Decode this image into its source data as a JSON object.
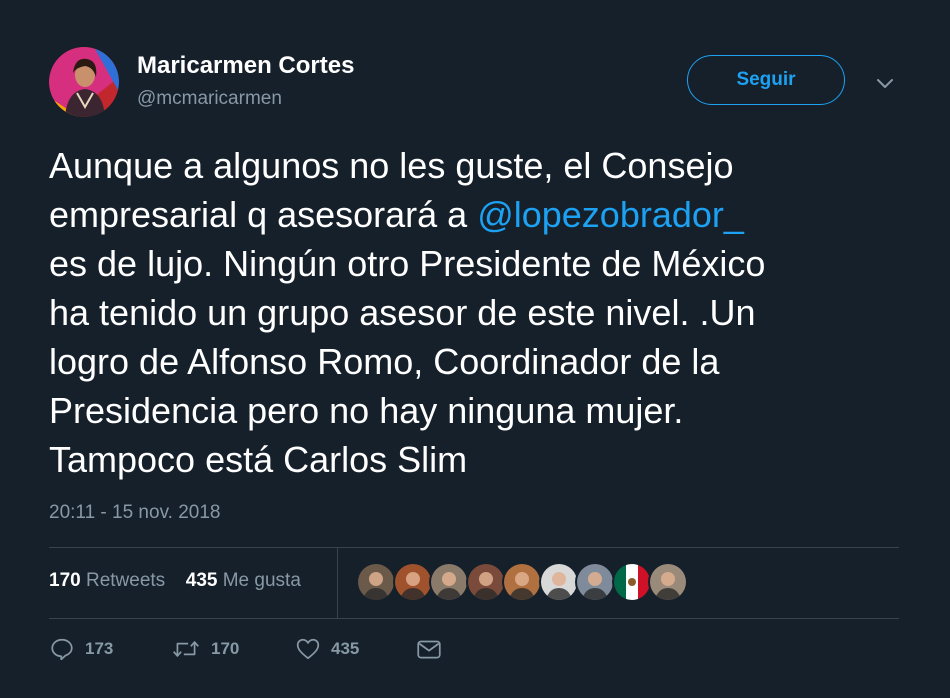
{
  "user": {
    "name": "Maricarmen Cortes",
    "handle": "@mcmaricarmen",
    "avatar_icon": "profile-photo"
  },
  "follow_button": {
    "label": "Seguir"
  },
  "tweet": {
    "lines": [
      {
        "before": "Aunque a algunos no les guste, el Consejo",
        "mention": "",
        "after": ""
      },
      {
        "before": "empresarial q asesorará a ",
        "mention": "@lopezobrador_",
        "after": ""
      },
      {
        "before": "es de lujo. Ningún otro Presidente de México",
        "mention": "",
        "after": ""
      },
      {
        "before": "ha tenido un grupo asesor de este nivel. .Un",
        "mention": "",
        "after": ""
      },
      {
        "before": "logro de Alfonso Romo, Coordinador de la",
        "mention": "",
        "after": ""
      },
      {
        "before": "Presidencia pero no hay ninguna mujer.",
        "mention": "",
        "after": ""
      },
      {
        "before": "Tampoco está Carlos Slim",
        "mention": "",
        "after": ""
      }
    ],
    "timestamp": "20:11 - 15 nov. 2018"
  },
  "stats": {
    "retweets_count": "170",
    "retweets_label": " Retweets",
    "likes_count": "435",
    "likes_label": " Me gusta"
  },
  "likers": [
    {
      "icon": "liker-avatar",
      "color": "#6b5a4a"
    },
    {
      "icon": "liker-avatar",
      "color": "#a0522d"
    },
    {
      "icon": "liker-avatar",
      "color": "#8a7a6a"
    },
    {
      "icon": "liker-avatar",
      "color": "#7a4a3a"
    },
    {
      "icon": "liker-avatar",
      "color": "#b07040"
    },
    {
      "icon": "liker-avatar",
      "color": "#d8d8d8"
    },
    {
      "icon": "liker-avatar",
      "color": "#7f8a9a"
    },
    {
      "icon": "mexico-flag-avatar",
      "color": "#ffffff"
    },
    {
      "icon": "liker-avatar",
      "color": "#9a8a7a"
    }
  ],
  "actions": {
    "reply_count": "173",
    "retweet_count": "170",
    "like_count": "435"
  },
  "colors": {
    "background": "#15202b",
    "accent": "#1da1f2",
    "secondary_text": "#8899a6",
    "divider": "#38444d"
  }
}
